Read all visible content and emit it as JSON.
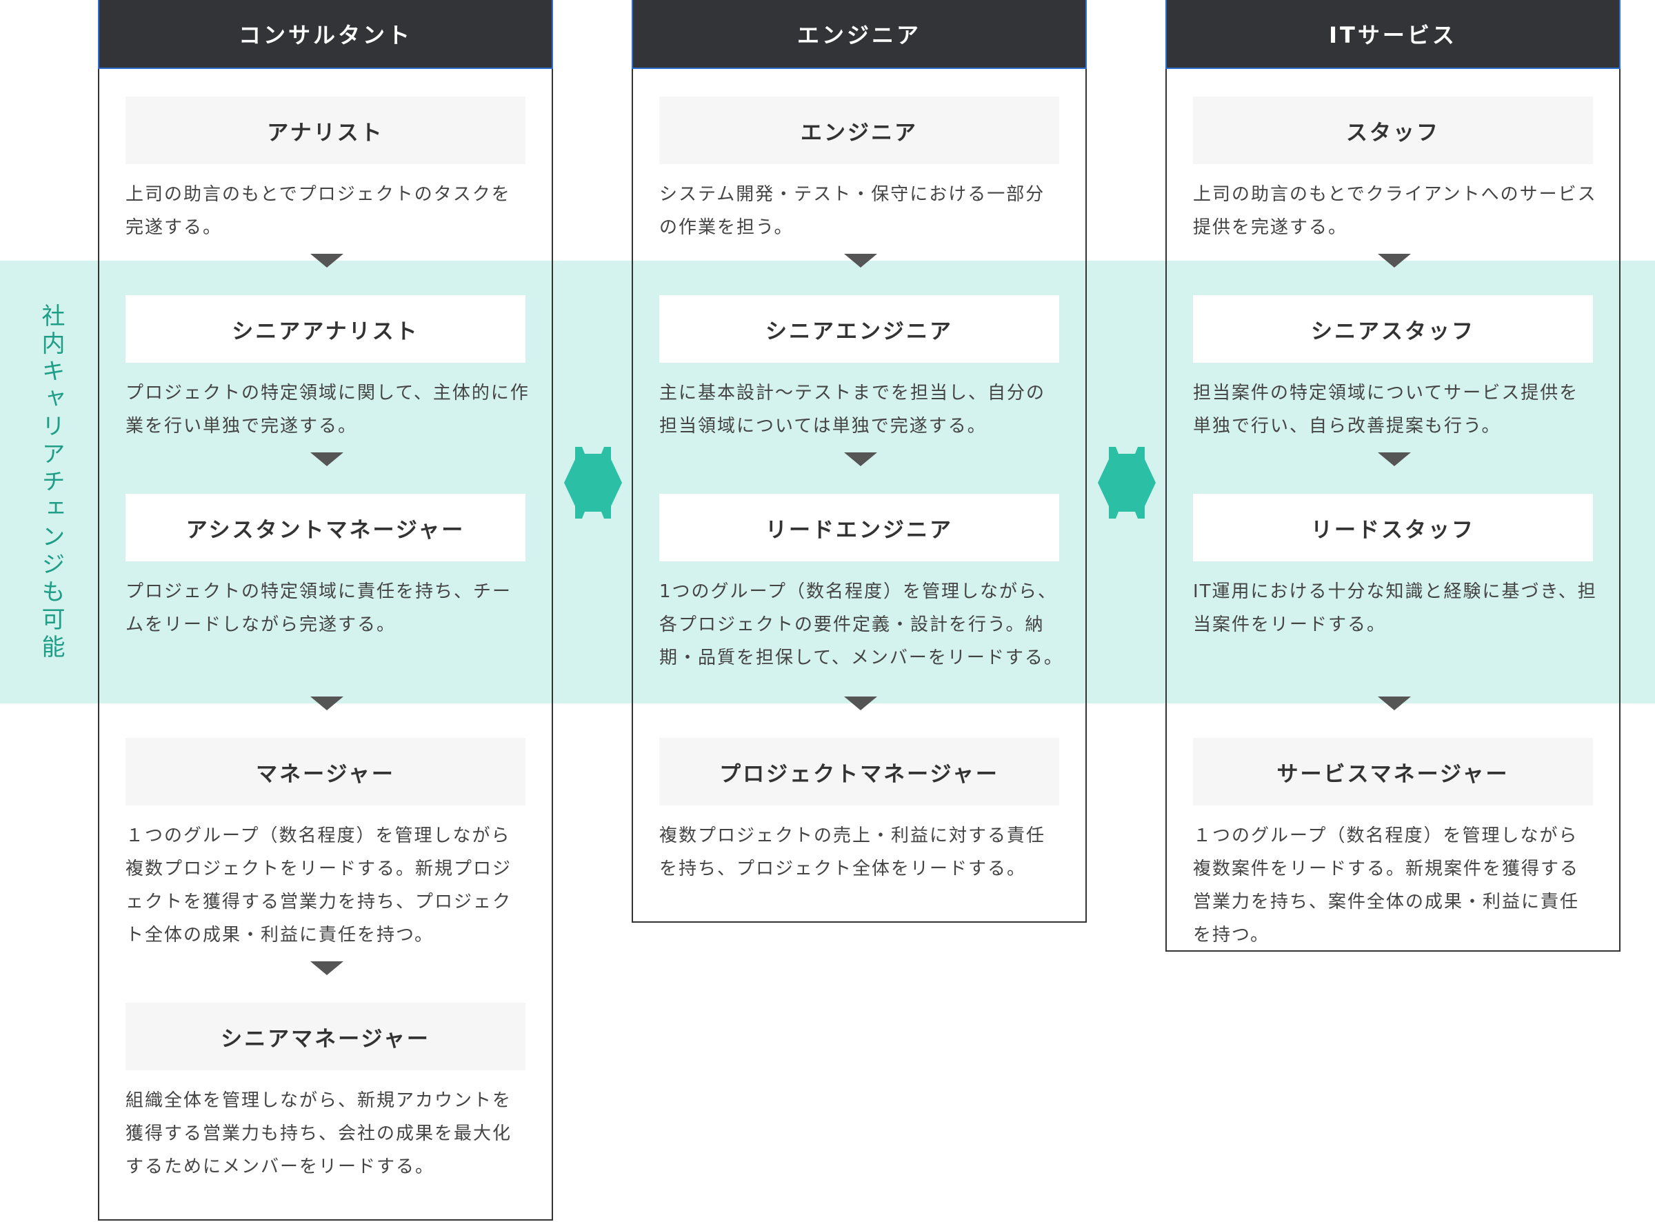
{
  "side_label": "社内キャリアチェンジも可能",
  "colors": {
    "band": "#d5f3ee",
    "accent": "#2bbfa6",
    "header_bg": "#333438",
    "header_border": "#2c6fcf"
  },
  "columns": [
    {
      "title": "コンサルタント",
      "roles": [
        {
          "name": "アナリスト",
          "desc": "上司の助言のもとでプロジェクトのタスクを完遂する。"
        },
        {
          "name": "シニアアナリスト",
          "desc": "プロジェクトの特定領域に関して、主体的に作業を行い単独で完遂する。"
        },
        {
          "name": "アシスタントマネージャー",
          "desc": "プロジェクトの特定領域に責任を持ち、チームをリードしながら完遂する。"
        },
        {
          "name": "マネージャー",
          "desc": "１つのグループ（数名程度）を管理しながら複数プロジェクトをリードする。新規プロジェクトを獲得する営業力を持ち、プロジェクト全体の成果・利益に責任を持つ。"
        },
        {
          "name": "シニアマネージャー",
          "desc": "組織全体を管理しながら、新規アカウントを獲得する営業力も持ち、会社の成果を最大化するためにメンバーをリードする。"
        }
      ]
    },
    {
      "title": "エンジニア",
      "roles": [
        {
          "name": "エンジニア",
          "desc": "システム開発・テスト・保守における一部分の作業を担う。"
        },
        {
          "name": "シニアエンジニア",
          "desc": "主に基本設計〜テストまでを担当し、自分の担当領域については単独で完遂する。"
        },
        {
          "name": "リードエンジニア",
          "desc": "1つのグループ（数名程度）を管理しながら、各プロジェクトの要件定義・設計を行う。納期・品質を担保して、メンバーをリードする。"
        },
        {
          "name": "プロジェクトマネージャー",
          "desc": "複数プロジェクトの売上・利益に対する責任を持ち、プロジェクト全体をリードする。"
        }
      ]
    },
    {
      "title": "ITサービス",
      "roles": [
        {
          "name": "スタッフ",
          "desc": "上司の助言のもとでクライアントへのサービス提供を完遂する。"
        },
        {
          "name": "シニアスタッフ",
          "desc": "担当案件の特定領域についてサービス提供を単独で行い、自ら改善提案も行う。"
        },
        {
          "name": "リードスタッフ",
          "desc": "IT運用における十分な知識と経験に基づき、担当案件をリードする。"
        },
        {
          "name": "サービスマネージャー",
          "desc": "１つのグループ（数名程度）を管理しながら複数案件をリードする。新規案件を獲得する営業力を持ち、案件全体の成果・利益に責任を持つ。"
        }
      ]
    }
  ]
}
